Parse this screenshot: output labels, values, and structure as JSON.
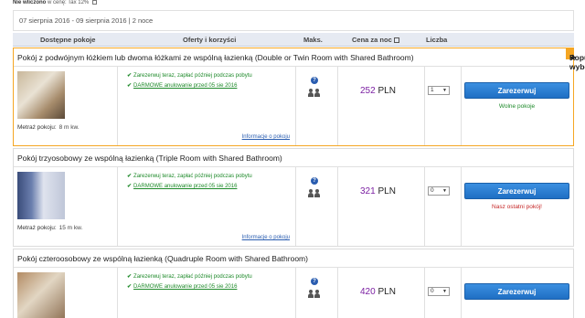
{
  "tax_note": {
    "label": "Nie wliczono",
    "text": "w cenę: Tax 12%"
  },
  "dates": {
    "text": "07 sierpnia 2016 - 09 sierpnia 2016 | 2 noce"
  },
  "table_headers": {
    "rooms": "Dostępne pokoje",
    "offers": "Oferty i korzyści",
    "max": "Maks.",
    "price": "Cena za noc",
    "count": "Liczba"
  },
  "rooms": [
    {
      "title": "Pokój z podwójnym łóżkiem lub dwoma łóżkami ze wspólną łazienką (Double or Twin Room with Shared Bathroom)",
      "badge": "Popularny wybór!",
      "area_label": "Metraż pokoju:",
      "area_value": "8 m kw.",
      "offer1": "Zarezerwuj teraz, zapłać później podczas pobytu",
      "offer2": "DARMOWE anulowanie przed 05 sie 2016",
      "info_link": "Informacje o pokoju",
      "max_icon": "?",
      "price_value": "252",
      "price_currency": "PLN",
      "qty": "1",
      "book_label": "Zarezerwuj",
      "availability": "Wolne pokoje"
    },
    {
      "title": "Pokój trzyosobowy ze wspólną łazienką (Triple Room with Shared Bathroom)",
      "area_label": "Metraż pokoju:",
      "area_value": "15 m kw.",
      "offer1": "Zarezerwuj teraz, zapłać później podczas pobytu",
      "offer2": "DARMOWE anulowanie przed 05 sie 2016",
      "info_link": "Informacje o pokoju",
      "max_icon": "?",
      "price_value": "321",
      "price_currency": "PLN",
      "qty": "0",
      "book_label": "Zarezerwuj",
      "availability": "Nasz ostatni pokój!"
    },
    {
      "title": "Pokój czteroosobowy ze wspólną łazienką (Quadruple Room with Shared Bathroom)",
      "offer1": "Zarezerwuj teraz, zapłać później podczas pobytu",
      "offer2": "DARMOWE anulowanie przed 05 sie 2016",
      "max_icon": "?",
      "price_value": "420",
      "price_currency": "PLN",
      "qty": "0",
      "book_label": "Zarezerwuj"
    }
  ],
  "colors": {
    "accent_orange": "#f5a623",
    "button_blue": "#1f6fc4",
    "offer_green": "#1e8a2a",
    "price_purple": "#7b1fa2",
    "warning_red": "#c62828"
  }
}
